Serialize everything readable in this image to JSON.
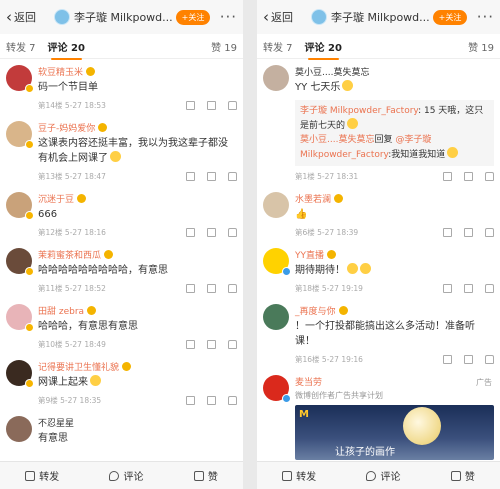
{
  "left": {
    "back_label": "返回",
    "account_name": "李子璇 Milkpowd...",
    "follow_label": "+关注",
    "more_label": "···",
    "tabs": [
      {
        "label": "转发 7"
      },
      {
        "label": "评论 20"
      }
    ],
    "like_count": "赞 19",
    "comments": [
      {
        "name": "软豆精玉米",
        "text": "码一个节目单",
        "meta": "第14楼 5-27 18:53",
        "avatar_color": "#c23b3b"
      },
      {
        "name": "豆子-妈妈爱你",
        "text": "这课表内容还挺丰富，我以为我这辈子都没有机会上网课了",
        "meta": "第13楼 5-27 18:47",
        "avatar_color": "#d9b58a"
      },
      {
        "name": "沉迷于豆",
        "text": "666",
        "meta": "第12楼 5-27 18:16",
        "avatar_color": "#c9a27a"
      },
      {
        "name": "茉莉蜜茶和西瓜",
        "text": "哈哈哈哈哈哈哈哈哈，有意思",
        "meta": "第11楼 5-27 18:52",
        "avatar_color": "#6a4b3a"
      },
      {
        "name": "田甜 zebra",
        "text": "哈哈哈，有意思有意思",
        "meta": "第10楼 5-27 18:49",
        "avatar_color": "#e8b4b8"
      },
      {
        "name": "记得要讲卫生懂礼貌",
        "text": "网课上起来",
        "meta": "第9楼 5-27 18:35",
        "avatar_color": "#3a2a20"
      },
      {
        "name": "不忍星星",
        "text": "有意思",
        "meta": "",
        "avatar_color": "#8a6a5a"
      }
    ],
    "bottom": {
      "repost": "转发",
      "comment": "评论",
      "like": "赞"
    }
  },
  "right": {
    "back_label": "返回",
    "account_name": "李子璇 Milkpowd...",
    "follow_label": "+关注",
    "more_label": "···",
    "tabs": [
      {
        "label": "转发 7"
      },
      {
        "label": "评论 20"
      }
    ],
    "like_count": "赞 19",
    "comments": [
      {
        "name": "莫小豆....莫失莫忘",
        "text": "YY 七天乐",
        "meta": "第1楼 5-27 18:31",
        "avatar_color": "#c4b0a0",
        "replies": [
          {
            "user": "李子璇 Milkpowder_Factory",
            "text": ": 15 天哦，这只是前七天的"
          },
          {
            "user": "莫小豆....莫失莫忘",
            "text": "回复 ",
            "target": "@李子璇 Milkpowder_Factory",
            "text2": ":我知道我知道"
          }
        ]
      },
      {
        "name": "水墨若澜",
        "text": "👍",
        "meta": "第6楼 5-27 18:39",
        "avatar_color": "#d8c4a8"
      },
      {
        "name": "YY直播",
        "text": "期待期待！",
        "meta": "第18楼 5-27 19:19",
        "avatar_color": "#ffd200"
      },
      {
        "name": "_再度与你",
        "text": "！一个打投都能搞出这么多活动！准备听课！",
        "meta": "第16楼 5-27 19:16",
        "avatar_color": "#4a7a5a"
      }
    ],
    "ad": {
      "name": "麦当劳",
      "tag": "广告",
      "sub": "微博创作者广告共享计划",
      "caption": "让孩子的画作",
      "logo": "M"
    },
    "bottom": {
      "repost": "转发",
      "comment": "评论",
      "like": "赞"
    }
  }
}
